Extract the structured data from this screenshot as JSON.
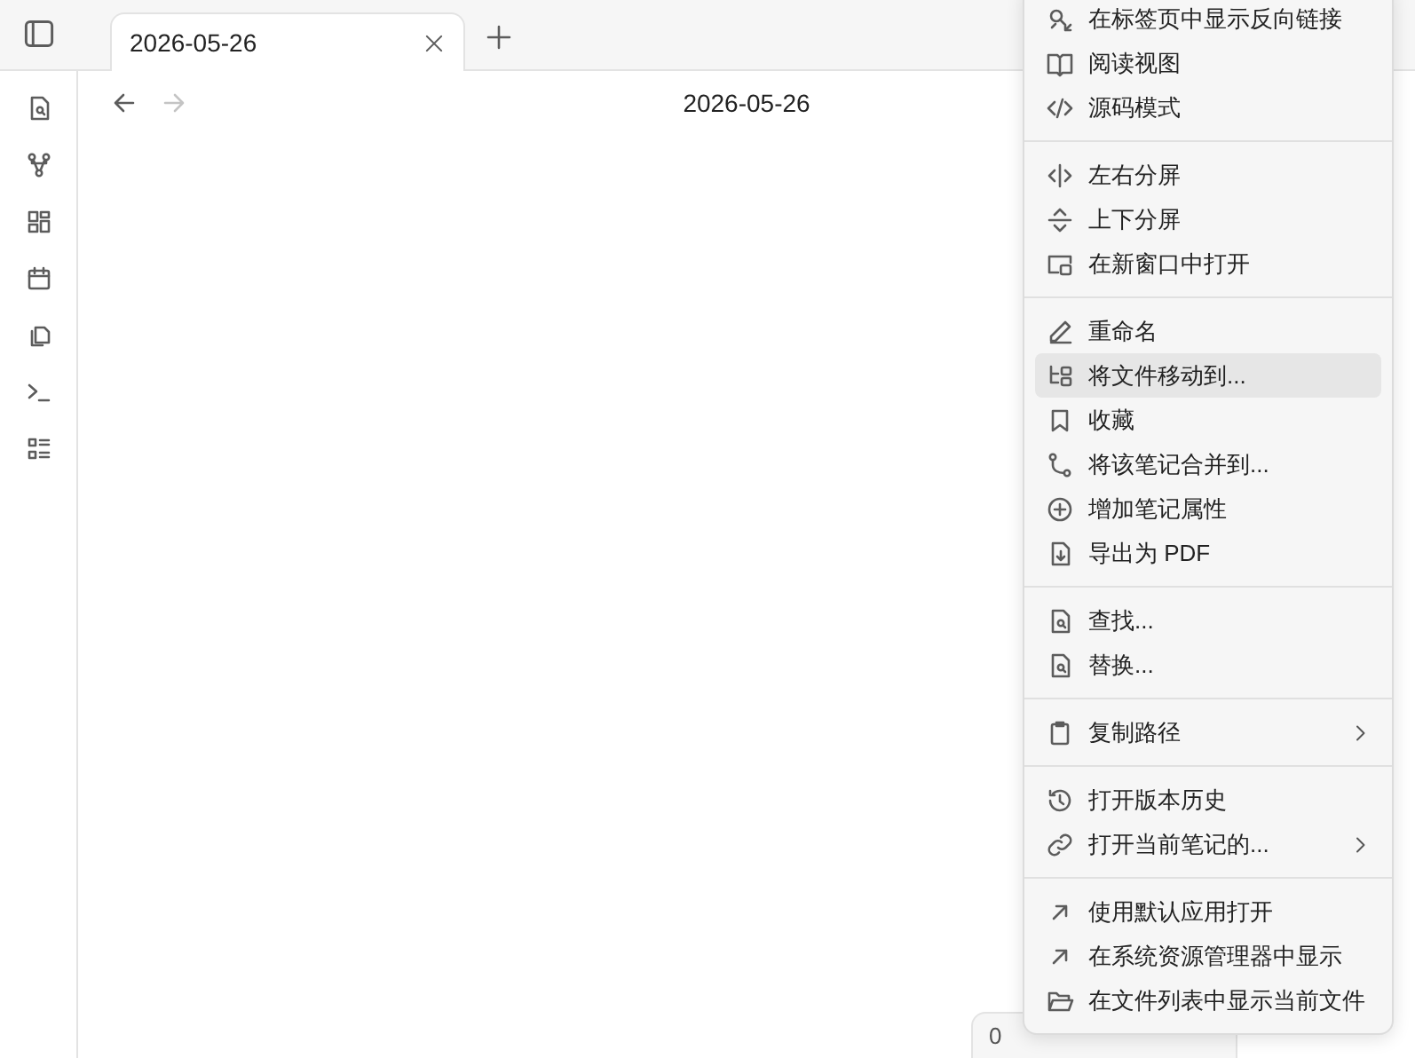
{
  "tabs": [
    {
      "title": "2026-05-26",
      "selected": true
    }
  ],
  "navigation": [
    {
      "disabled": false
    },
    {
      "disabled": true
    }
  ],
  "note": {
    "title": "2026-05-26"
  },
  "status_bar": {
    "text": "0"
  },
  "context_menu": {
    "sections": [
      {
        "items": [
          {
            "label": "在标签页中显示反向链接",
            "selected": false,
            "submenu": false
          },
          {
            "label": "阅读视图",
            "selected": false,
            "submenu": false
          },
          {
            "label": "源码模式",
            "selected": false,
            "submenu": false
          }
        ]
      },
      {
        "items": [
          {
            "label": "左右分屏",
            "selected": false,
            "submenu": false
          },
          {
            "label": "上下分屏",
            "selected": false,
            "submenu": false
          },
          {
            "label": "在新窗口中打开",
            "selected": false,
            "submenu": false
          }
        ]
      },
      {
        "items": [
          {
            "label": "重命名",
            "selected": false,
            "submenu": false
          },
          {
            "label": "将文件移动到...",
            "selected": true,
            "submenu": false
          },
          {
            "label": "收藏",
            "selected": false,
            "submenu": false
          },
          {
            "label": "将该笔记合并到...",
            "selected": false,
            "submenu": false
          },
          {
            "label": "增加笔记属性",
            "selected": false,
            "submenu": false
          },
          {
            "label": "导出为 PDF",
            "selected": false,
            "submenu": false
          }
        ]
      },
      {
        "items": [
          {
            "label": "查找...",
            "selected": false,
            "submenu": false
          },
          {
            "label": "替换...",
            "selected": false,
            "submenu": false
          }
        ]
      },
      {
        "items": [
          {
            "label": "复制路径",
            "selected": false,
            "submenu": true
          }
        ]
      },
      {
        "items": [
          {
            "label": "打开版本历史",
            "selected": false,
            "submenu": false
          },
          {
            "label": "打开当前笔记的...",
            "selected": false,
            "submenu": true
          }
        ]
      },
      {
        "items": [
          {
            "label": "使用默认应用打开",
            "selected": false,
            "submenu": false
          },
          {
            "label": "在系统资源管理器中显示",
            "selected": false,
            "submenu": false
          },
          {
            "label": "在文件列表中显示当前文件",
            "selected": false,
            "submenu": false
          }
        ]
      }
    ]
  }
}
